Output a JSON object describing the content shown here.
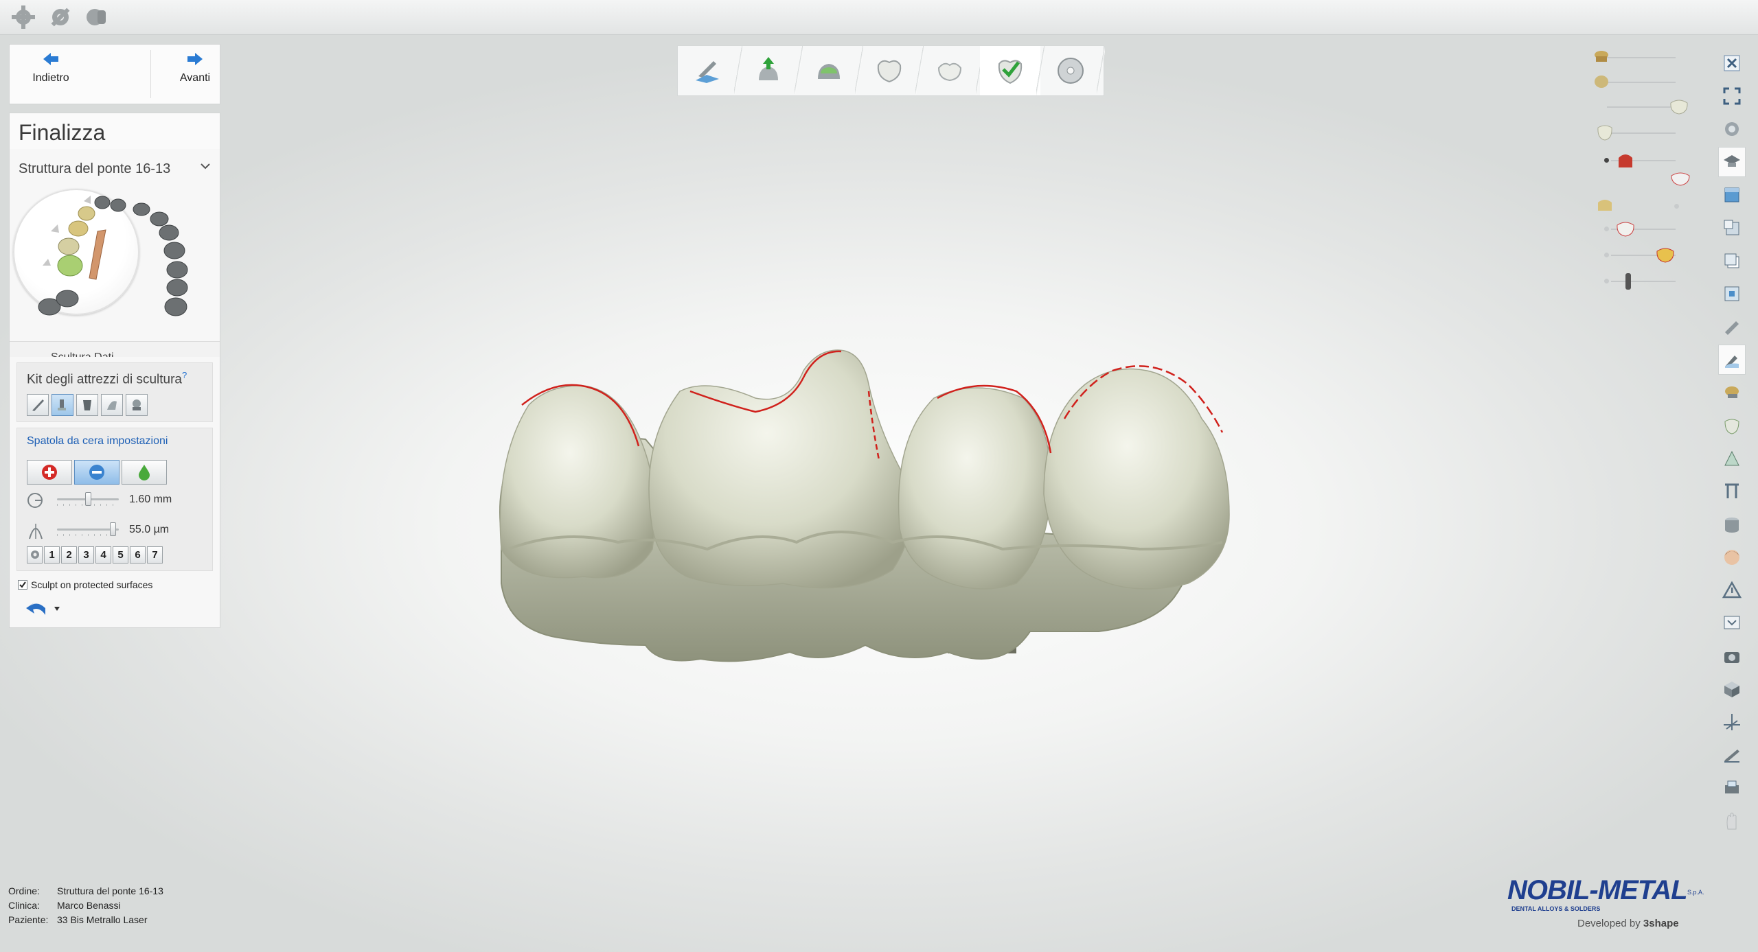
{
  "nav": {
    "back_label": "Indietro",
    "forward_label": "Avanti"
  },
  "panel": {
    "title": "Finalizza",
    "structure_select": "Struttura del ponte 16-13",
    "partial_section": "Scultura Dati...",
    "kit_title": "Kit degli attrezzi di scultura",
    "kit_help": "?",
    "tools": [
      "wax-knife-icon",
      "smooth-icon",
      "add-remove-icon",
      "morph-icon",
      "anatomy-icon"
    ],
    "settings_title": "Spatola da cera impostazioni",
    "modes": [
      "add-icon",
      "smooth-icon",
      "drop-icon"
    ],
    "radius_value": "1.60 mm",
    "radius_fraction": 0.5,
    "strength_value": "55.0 µm",
    "strength_fraction": 0.95,
    "presets": [
      "1",
      "2",
      "3",
      "4",
      "5",
      "6",
      "7"
    ],
    "sculpt_protected_label": "Sculpt on protected surfaces",
    "sculpt_protected_checked": true
  },
  "workflow_steps": [
    {
      "name": "step-margin-icon",
      "current": false
    },
    {
      "name": "step-insertion-icon",
      "current": false
    },
    {
      "name": "step-cement-gap-icon",
      "current": false
    },
    {
      "name": "step-anatomy-icon",
      "current": false
    },
    {
      "name": "step-crown-icon",
      "current": false
    },
    {
      "name": "step-finalize-icon",
      "current": true
    },
    {
      "name": "step-save-icon",
      "current": false
    }
  ],
  "right_toolbar": [
    "close-icon",
    "fullscreen-icon",
    "rotate-view-icon",
    "hat-icon",
    "view-front-icon",
    "view-side-icon",
    "view-copy-icon",
    "view-box-icon",
    "measure-icon",
    "sculpt-icon",
    "tooth-tool-icon",
    "tooth-cup-icon",
    "crown-tool-icon",
    "section-icon",
    "cylinder-icon",
    "face-icon",
    "warning-icon",
    "screen-icon",
    "camera-icon",
    "cube-icon",
    "axis-icon",
    "ruler-icon",
    "print-icon",
    "hand-icon"
  ],
  "info": {
    "order_label": "Ordine:",
    "order_value": "Struttura del ponte 16-13",
    "clinic_label": "Clinica:",
    "clinic_value": "Marco Benassi",
    "patient_label": "Paziente:",
    "patient_value": "33 Bis Metrallo Laser"
  },
  "logo": {
    "brand": "NOBIL-METAL",
    "suffix": "S.p.A.",
    "tagline": "DENTAL ALLOYS & SOLDERS",
    "developed": "Developed by",
    "developer": "3shape"
  },
  "colors": {
    "accent_blue": "#2a7bd3",
    "margin_line_red": "#d0211c",
    "tooth_surface": "#d9dccb",
    "brand_blue": "#1f3f8f"
  }
}
